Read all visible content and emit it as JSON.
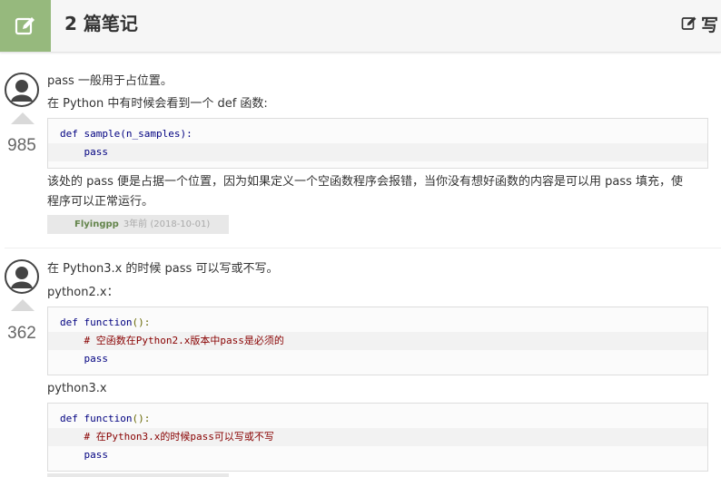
{
  "header": {
    "title": "2 篇笔记",
    "write_label": "写",
    "accent_color": "#96b97d"
  },
  "notes": [
    {
      "votes": "985",
      "line1": "pass 一般用于占位置。",
      "line2": "在 Python 中有时候会看到一个 def 函数:",
      "code": {
        "kw": "def",
        "sig": " sample(n_samples):",
        "body": "pass"
      },
      "para": "该处的 pass 便是占据一个位置，因为如果定义一个空函数程序会报错，当你没有想好函数的内容是可以用 pass 填充，使程序可以正常运行。",
      "author": "Flyingpp",
      "time": "3年前 (2018-10-01)"
    },
    {
      "votes": "362",
      "line1": "在 Python3.x 的时候 pass 可以写或不写。",
      "label_py2": "python2.x：",
      "code_py2": {
        "kw": "def",
        "fn": " function",
        "paren": "():",
        "comment": "# 空函数在Python2.x版本中pass是必须的",
        "body": "pass"
      },
      "label_py3": "python3.x",
      "code_py3": {
        "kw": "def",
        "fn": " function",
        "paren": "():",
        "comment": "# 在Python3.x的时候pass可以写或不写",
        "body": "pass"
      }
    }
  ]
}
